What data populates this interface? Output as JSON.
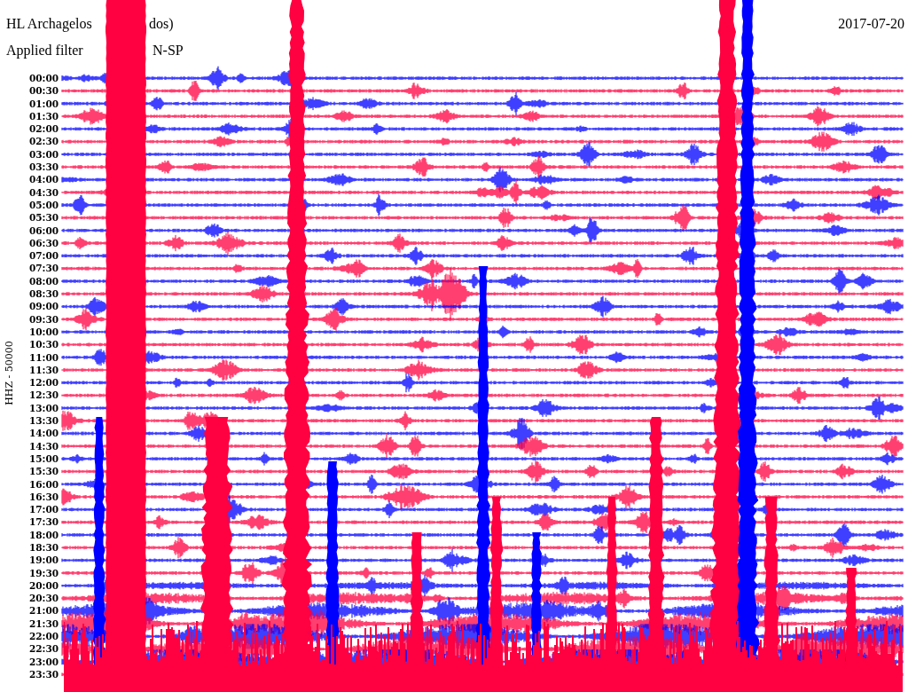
{
  "header": {
    "station_visible_start": "HL Archagelos",
    "station_visible_end": "dos)",
    "filter_label": "Applied filter",
    "filter_visible_end": "N-SP",
    "date": "2017-07-20"
  },
  "axis_label": "HHZ - 50000",
  "rows": [
    {
      "time": "00:00",
      "color": "#0000ff"
    },
    {
      "time": "00:30",
      "color": "#ff0040"
    },
    {
      "time": "01:00",
      "color": "#0000ff"
    },
    {
      "time": "01:30",
      "color": "#ff0040"
    },
    {
      "time": "02:00",
      "color": "#0000ff"
    },
    {
      "time": "02:30",
      "color": "#ff0040"
    },
    {
      "time": "03:00",
      "color": "#0000ff"
    },
    {
      "time": "03:30",
      "color": "#ff0040"
    },
    {
      "time": "04:00",
      "color": "#0000ff"
    },
    {
      "time": "04:30",
      "color": "#ff0040"
    },
    {
      "time": "05:00",
      "color": "#0000ff"
    },
    {
      "time": "05:30",
      "color": "#ff0040"
    },
    {
      "time": "06:00",
      "color": "#0000ff"
    },
    {
      "time": "06:30",
      "color": "#ff0040"
    },
    {
      "time": "07:00",
      "color": "#0000ff"
    },
    {
      "time": "07:30",
      "color": "#ff0040"
    },
    {
      "time": "08:00",
      "color": "#0000ff"
    },
    {
      "time": "08:30",
      "color": "#ff0040"
    },
    {
      "time": "09:00",
      "color": "#0000ff"
    },
    {
      "time": "09:30",
      "color": "#ff0040"
    },
    {
      "time": "10:00",
      "color": "#0000ff"
    },
    {
      "time": "10:30",
      "color": "#ff0040"
    },
    {
      "time": "11:00",
      "color": "#0000ff"
    },
    {
      "time": "11:30",
      "color": "#ff0040"
    },
    {
      "time": "12:00",
      "color": "#0000ff"
    },
    {
      "time": "12:30",
      "color": "#ff0040"
    },
    {
      "time": "13:00",
      "color": "#0000ff"
    },
    {
      "time": "13:30",
      "color": "#ff0040"
    },
    {
      "time": "14:00",
      "color": "#0000ff"
    },
    {
      "time": "14:30",
      "color": "#ff0040"
    },
    {
      "time": "15:00",
      "color": "#0000ff"
    },
    {
      "time": "15:30",
      "color": "#ff0040"
    },
    {
      "time": "16:00",
      "color": "#0000ff"
    },
    {
      "time": "16:30",
      "color": "#ff0040"
    },
    {
      "time": "17:00",
      "color": "#0000ff"
    },
    {
      "time": "17:30",
      "color": "#ff0040"
    },
    {
      "time": "18:00",
      "color": "#0000ff"
    },
    {
      "time": "18:30",
      "color": "#ff0040"
    },
    {
      "time": "19:00",
      "color": "#0000ff"
    },
    {
      "time": "19:30",
      "color": "#ff0040"
    },
    {
      "time": "20:00",
      "color": "#0000ff"
    },
    {
      "time": "20:30",
      "color": "#ff0040"
    },
    {
      "time": "21:00",
      "color": "#0000ff"
    },
    {
      "time": "21:30",
      "color": "#ff0040"
    },
    {
      "time": "22:00",
      "color": "#0000ff"
    },
    {
      "time": "22:30",
      "color": "#ff0040"
    },
    {
      "time": "23:00",
      "color": "#0000ff"
    },
    {
      "time": "23:30",
      "color": "#ff0040"
    }
  ]
}
